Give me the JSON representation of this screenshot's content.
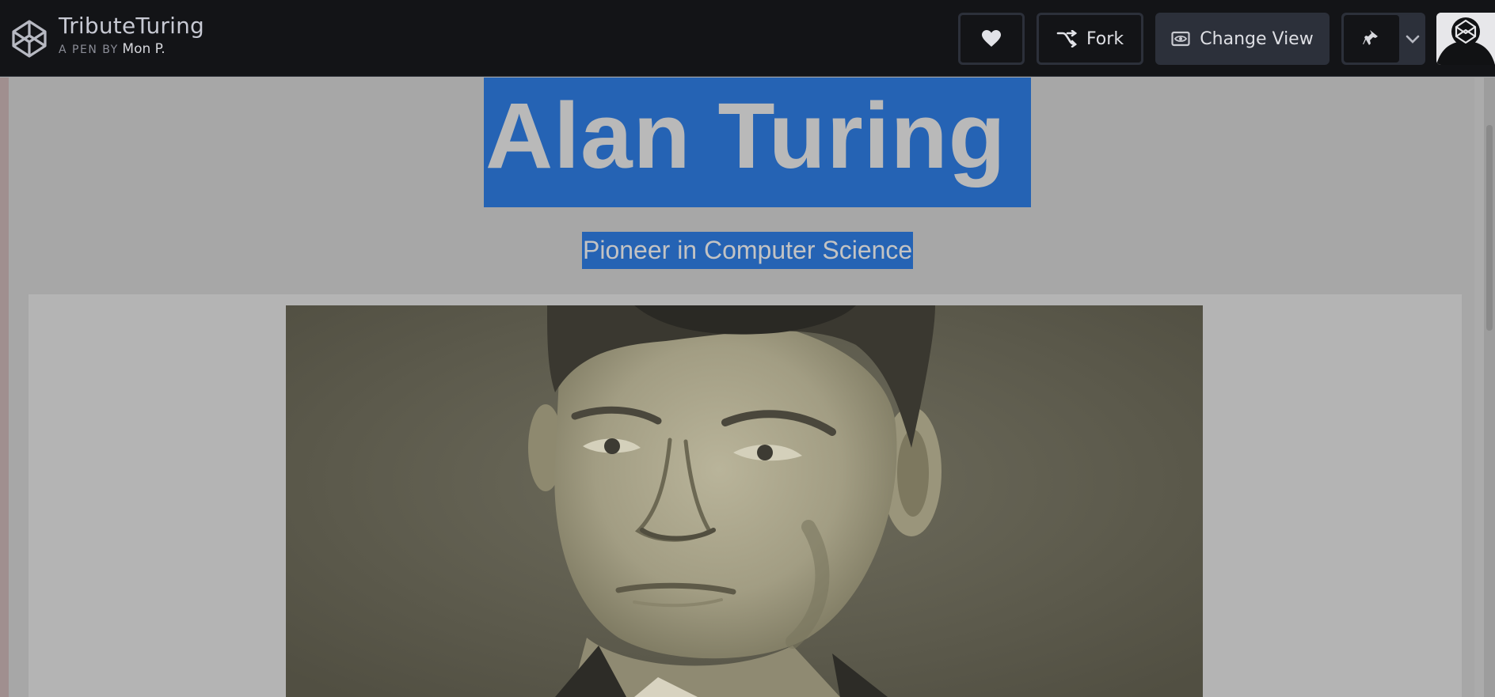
{
  "header": {
    "pen_title": "TributeTuring",
    "byline_prefix": "A PEN BY",
    "author": "Mon P.",
    "buttons": {
      "fork": "Fork",
      "change_view": "Change View"
    }
  },
  "icons": {
    "logo": "codepen-logo-icon",
    "heart": "heart-icon",
    "fork": "fork-icon",
    "view": "eye-icon",
    "pin": "pin-icon",
    "caret": "chevron-down-icon",
    "avatar": "codepen-avatar"
  },
  "page": {
    "title": "Alan Turing",
    "subtitle": "Pioneer in Computer Science",
    "image_alt": "Portrait photograph of Alan Turing"
  },
  "colors": {
    "header_bg": "#131417",
    "selection": "#2563b4",
    "button_dark": "#2c303a",
    "preview_overlay": "#a7a7a7"
  }
}
